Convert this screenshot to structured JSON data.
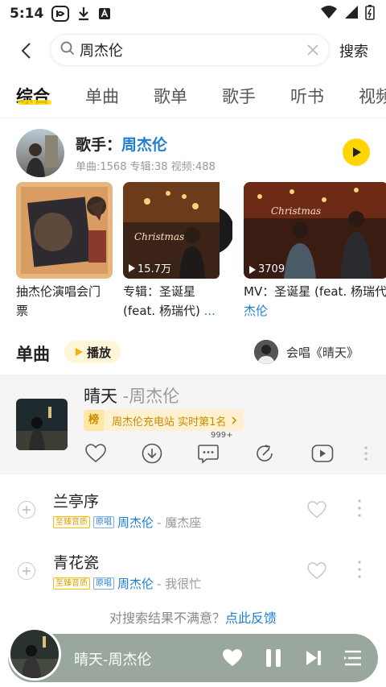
{
  "status": {
    "time": "5:14"
  },
  "search": {
    "query": "周杰伦",
    "button": "搜索"
  },
  "tabs": [
    "综合",
    "单曲",
    "歌单",
    "歌手",
    "听书",
    "视频"
  ],
  "artist": {
    "prefix": "歌手：",
    "name": "周杰伦",
    "stats": "单曲:1568  专辑:38  视频:488"
  },
  "cards": [
    {
      "caption_line1": "抽杰伦演唱会门",
      "caption_line2": "票"
    },
    {
      "count": "15.7万",
      "caption_line1": "专辑：圣诞星",
      "caption_line2": "(feat. 杨瑞代) ..."
    },
    {
      "count": "3709",
      "caption_line1": "MV：圣诞星 (feat. 杨瑞代",
      "caption_line2": "杰伦"
    }
  ],
  "songs_section": {
    "title": "单曲",
    "play_label": "播放",
    "cover_label": "会唱《晴天》"
  },
  "featured": {
    "title": "晴天",
    "artist": " -周杰伦",
    "rank_badge": "榜",
    "rank_text": "周杰伦充电站 实时第1名",
    "comment_count": "999+"
  },
  "songs": [
    {
      "title": "兰亭序",
      "quality": "至臻音质",
      "original": "原唱",
      "artist": "周杰伦",
      "album": " - 魔杰座"
    },
    {
      "title": "青花瓷",
      "quality": "至臻音质",
      "original": "原唱",
      "artist": "周杰伦",
      "album": " - 我很忙"
    }
  ],
  "feedback": {
    "question": "对搜索结果不满意？",
    "link": "点此反馈"
  },
  "player": {
    "title": "晴天-周杰伦"
  },
  "colors": {
    "accent": "#ffd600",
    "link": "#1e7fd0",
    "player_bg": "#9aa79c"
  }
}
